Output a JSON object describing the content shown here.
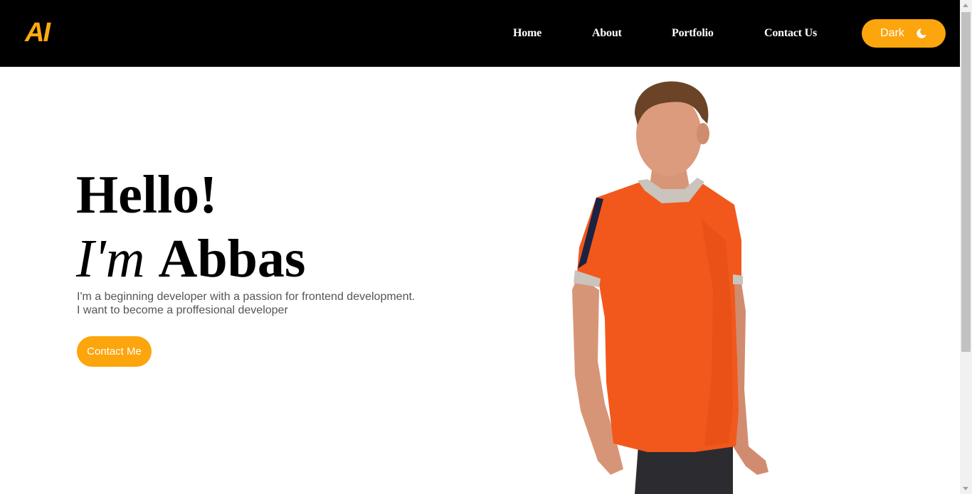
{
  "header": {
    "logo": "AI",
    "nav": [
      {
        "label": "Home"
      },
      {
        "label": "About"
      },
      {
        "label": "Portfolio"
      },
      {
        "label": "Contact Us"
      }
    ],
    "theme_toggle": {
      "label": "Dark",
      "icon": "moon-icon"
    }
  },
  "hero": {
    "greeting": "Hello!",
    "im": "I'm",
    "name": "Abbas",
    "description": [
      "I'm a beginning developer with a passion for frontend development.",
      "I want to become a proffesional developer"
    ],
    "cta": "Contact Me"
  },
  "colors": {
    "accent": "#fca50d",
    "logo": "#fcaa0f",
    "header_bg": "#000000",
    "shirt": "#f2581c"
  }
}
